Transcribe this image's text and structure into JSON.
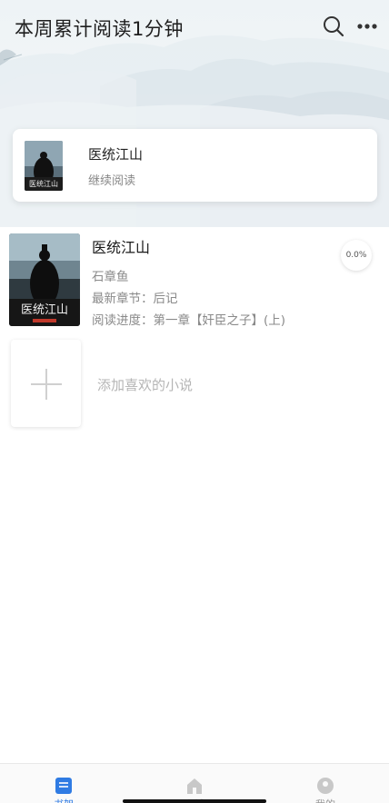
{
  "header": {
    "title": "本周累计阅读1分钟",
    "search_icon": "search-icon",
    "more_icon": "more-icon"
  },
  "continue_reading": {
    "title": "医统江山",
    "subtitle": "继续阅读"
  },
  "bookshelf": [
    {
      "title": "医统江山",
      "author": "石章鱼",
      "latest_chapter": "最新章节：后记",
      "reading_progress": "阅读进度：第一章【奸臣之子】(上)",
      "progress_percent": "0.0%",
      "cover_text": "医统江山"
    }
  ],
  "add_book": {
    "label": "添加喜欢的小说"
  },
  "tabbar": {
    "items": [
      {
        "label": "书架",
        "icon": "bookshelf-icon",
        "active": true
      },
      {
        "label": "书城",
        "icon": "bookstore-icon",
        "active": false
      },
      {
        "label": "我的",
        "icon": "profile-icon",
        "active": false
      }
    ]
  },
  "colors": {
    "accent": "#2f7be3",
    "text_primary": "#1a1a1a",
    "text_secondary": "#8a8a8a"
  }
}
